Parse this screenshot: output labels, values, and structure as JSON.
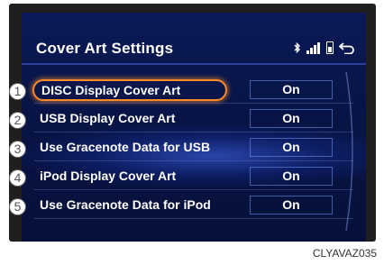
{
  "screen": {
    "title": "Cover Art Settings",
    "status_icons": [
      "bluetooth-icon",
      "signal-icon",
      "battery-icon",
      "back-icon"
    ]
  },
  "settings": [
    {
      "number": "1",
      "label": "DISC Display Cover Art",
      "value": "On",
      "selected": true
    },
    {
      "number": "2",
      "label": "USB Display Cover Art",
      "value": "On",
      "selected": false
    },
    {
      "number": "3",
      "label": "Use Gracenote Data for USB",
      "value": "On",
      "selected": false
    },
    {
      "number": "4",
      "label": "iPod Display Cover Art",
      "value": "On",
      "selected": false
    },
    {
      "number": "5",
      "label": "Use Gracenote Data for iPod",
      "value": "On",
      "selected": false
    }
  ],
  "image_code": "CLYAVAZ035",
  "colors": {
    "screen_bg": "#0b1a57",
    "selection_outline": "#ff8a2a",
    "text": "#ffffff"
  }
}
